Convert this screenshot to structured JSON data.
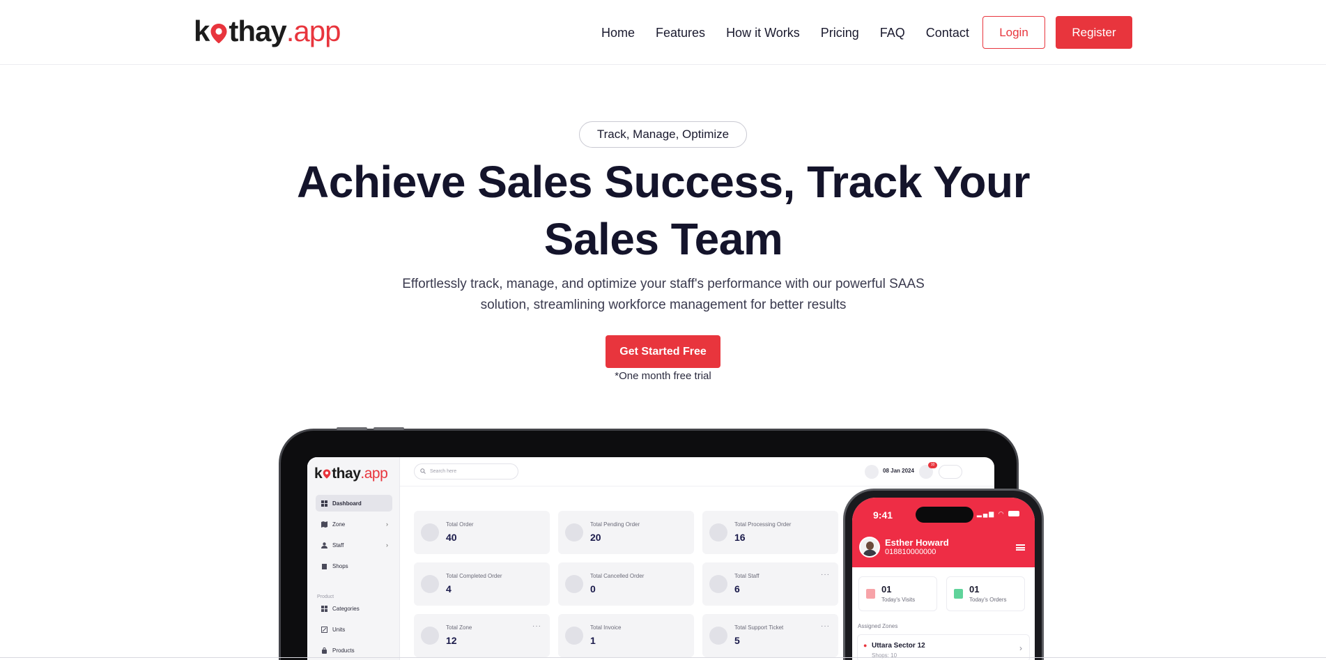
{
  "brand": {
    "part1": "k",
    "part2": "thay",
    "part3": ".app"
  },
  "nav": {
    "items": [
      "Home",
      "Features",
      "How it Works",
      "Pricing",
      "FAQ",
      "Contact"
    ],
    "login_label": "Login",
    "register_label": "Register"
  },
  "hero": {
    "pill": "Track, Manage, Optimize",
    "title_line1": "Achieve Sales Success, Track Your",
    "title_line2": "Sales Team",
    "subtitle_line1": "Effortlessly track, manage, and optimize your staff's performance with our powerful SAAS",
    "subtitle_line2": "solution, streamlining workforce management for better results",
    "cta_label": "Get Started Free",
    "trial_note": "*One month free trial"
  },
  "dashboard": {
    "search_placeholder": "Search here",
    "date": "08 Jan 2024",
    "notification_count": "10",
    "sidebar": {
      "items": [
        "Dashboard",
        "Zone",
        "Staff",
        "Shops"
      ],
      "section_label": "Product",
      "product_items": [
        "Categories",
        "Units",
        "Products"
      ]
    },
    "cards": [
      {
        "label": "Total Order",
        "value": "40"
      },
      {
        "label": "Total Pending Order",
        "value": "20"
      },
      {
        "label": "Total Processing Order",
        "value": "16"
      },
      {
        "label": "Total Completed Order",
        "value": "4"
      },
      {
        "label": "Total Cancelled Order",
        "value": "0"
      },
      {
        "label": "Total Staff",
        "value": "6"
      },
      {
        "label": "Total Zone",
        "value": "12"
      },
      {
        "label": "Total Invoice",
        "value": "1"
      },
      {
        "label": "Total Support Ticket",
        "value": "5"
      }
    ],
    "dots": "···"
  },
  "phone": {
    "time": "9:41",
    "status_icons": "▂▄▆ ◠",
    "user_name": "Esther Howard",
    "user_phone": "018810000000",
    "stats": [
      {
        "value": "01",
        "label": "Today's Visits",
        "color": "#f7a3a8"
      },
      {
        "value": "01",
        "label": "Today's Orders",
        "color": "#5fd39a"
      }
    ],
    "zones_label": "Assigned Zones",
    "zone_name": "Uttara Sector 12",
    "zone_sub": "Shops: 10",
    "zone_chevron": "›"
  },
  "colors": {
    "accent": "#e8353d",
    "phone_header": "#ee2d45",
    "text": "#14142b"
  }
}
